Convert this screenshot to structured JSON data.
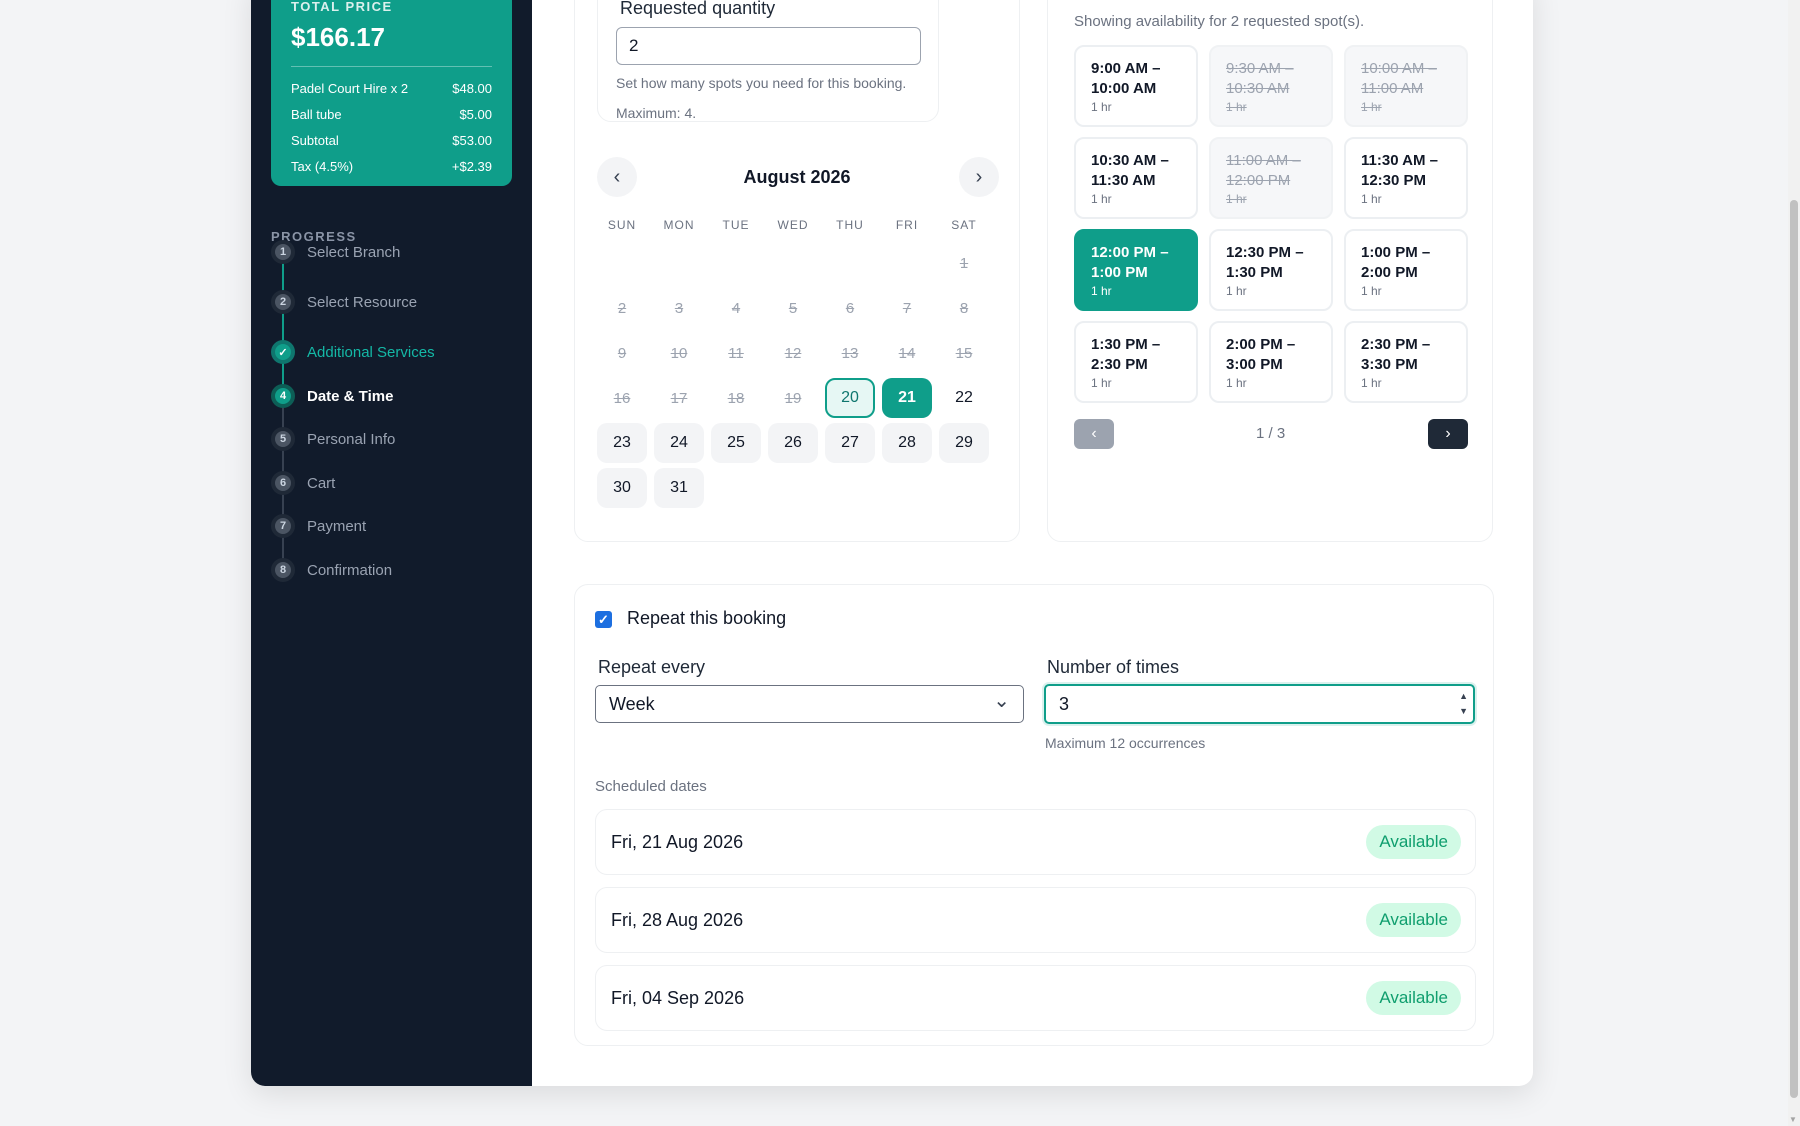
{
  "price": {
    "label": "TOTAL PRICE",
    "total": "$166.17",
    "rows": [
      {
        "name": "Padel Court Hire x 2",
        "amount": "$48.00"
      },
      {
        "name": "Ball tube",
        "amount": "$5.00"
      },
      {
        "name": "Subtotal",
        "amount": "$53.00"
      },
      {
        "name": "Tax (4.5%)",
        "amount": "+$2.39"
      }
    ]
  },
  "progress": {
    "title": "PROGRESS",
    "steps": [
      {
        "num": "1",
        "label": "Select Branch",
        "state": "pending"
      },
      {
        "num": "2",
        "label": "Select Resource",
        "state": "pending"
      },
      {
        "num": "✓",
        "label": "Additional Services",
        "state": "done"
      },
      {
        "num": "4",
        "label": "Date & Time",
        "state": "current"
      },
      {
        "num": "5",
        "label": "Personal Info",
        "state": "pending"
      },
      {
        "num": "6",
        "label": "Cart",
        "state": "pending"
      },
      {
        "num": "7",
        "label": "Payment",
        "state": "pending"
      },
      {
        "num": "8",
        "label": "Confirmation",
        "state": "pending"
      }
    ]
  },
  "quantity": {
    "label": "Requested quantity",
    "value": "2",
    "help": "Set how many spots you need for this booking.",
    "max": "Maximum: 4."
  },
  "calendar": {
    "month": "August 2026",
    "prev_icon": "‹",
    "next_icon": "›",
    "dow": [
      "SUN",
      "MON",
      "TUE",
      "WED",
      "THU",
      "FRI",
      "SAT"
    ],
    "weeks": [
      [
        null,
        null,
        null,
        null,
        null,
        null,
        {
          "d": "1",
          "s": "past"
        }
      ],
      [
        {
          "d": "2",
          "s": "past"
        },
        {
          "d": "3",
          "s": "past"
        },
        {
          "d": "4",
          "s": "past"
        },
        {
          "d": "5",
          "s": "past"
        },
        {
          "d": "6",
          "s": "past"
        },
        {
          "d": "7",
          "s": "past"
        },
        {
          "d": "8",
          "s": "past"
        }
      ],
      [
        {
          "d": "9",
          "s": "past"
        },
        {
          "d": "10",
          "s": "past"
        },
        {
          "d": "11",
          "s": "past"
        },
        {
          "d": "12",
          "s": "past"
        },
        {
          "d": "13",
          "s": "past"
        },
        {
          "d": "14",
          "s": "past"
        },
        {
          "d": "15",
          "s": "past"
        }
      ],
      [
        {
          "d": "16",
          "s": "past"
        },
        {
          "d": "17",
          "s": "past"
        },
        {
          "d": "18",
          "s": "past"
        },
        {
          "d": "19",
          "s": "past"
        },
        {
          "d": "20",
          "s": "today"
        },
        {
          "d": "21",
          "s": "selected"
        },
        {
          "d": "22",
          "s": "normal"
        }
      ],
      [
        {
          "d": "23",
          "s": "avail"
        },
        {
          "d": "24",
          "s": "avail"
        },
        {
          "d": "25",
          "s": "avail"
        },
        {
          "d": "26",
          "s": "avail"
        },
        {
          "d": "27",
          "s": "avail"
        },
        {
          "d": "28",
          "s": "avail"
        },
        {
          "d": "29",
          "s": "avail"
        }
      ],
      [
        {
          "d": "30",
          "s": "avail"
        },
        {
          "d": "31",
          "s": "avail"
        },
        null,
        null,
        null,
        null,
        null
      ]
    ]
  },
  "slots": {
    "info": "Showing availability for 2 requested spot(s).",
    "items": [
      {
        "time": "9:00 AM –\n10:00 AM",
        "dur": "1 hr",
        "state": "open"
      },
      {
        "time": "9:30 AM –\n10:30 AM",
        "dur": "1 hr",
        "state": "booked"
      },
      {
        "time": "10:00 AM –\n11:00 AM",
        "dur": "1 hr",
        "state": "booked"
      },
      {
        "time": "10:30 AM –\n11:30 AM",
        "dur": "1 hr",
        "state": "open"
      },
      {
        "time": "11:00 AM –\n12:00 PM",
        "dur": "1 hr",
        "state": "booked"
      },
      {
        "time": "11:30 AM –\n12:30 PM",
        "dur": "1 hr",
        "state": "open"
      },
      {
        "time": "12:00 PM –\n1:00 PM",
        "dur": "1 hr",
        "state": "selected"
      },
      {
        "time": "12:30 PM –\n1:30 PM",
        "dur": "1 hr",
        "state": "open"
      },
      {
        "time": "1:00 PM –\n2:00 PM",
        "dur": "1 hr",
        "state": "open"
      },
      {
        "time": "1:30 PM –\n2:30 PM",
        "dur": "1 hr",
        "state": "open"
      },
      {
        "time": "2:00 PM –\n3:00 PM",
        "dur": "1 hr",
        "state": "open"
      },
      {
        "time": "2:30 PM –\n3:30 PM",
        "dur": "1 hr",
        "state": "open"
      }
    ],
    "page": "1 / 3",
    "prev_icon": "‹",
    "next_icon": "›"
  },
  "repeat": {
    "checkbox_label": "Repeat this booking",
    "checked_icon": "✓",
    "every_label": "Repeat every",
    "every_value": "Week",
    "chevron_icon": "⌄",
    "times_label": "Number of times",
    "times_value": "3",
    "times_help": "Maximum 12 occurrences",
    "scheduled_title": "Scheduled dates",
    "dates": [
      {
        "date": "Fri, 21 Aug 2026",
        "status": "Available"
      },
      {
        "date": "Fri, 28 Aug 2026",
        "status": "Available"
      },
      {
        "date": "Fri, 04 Sep 2026",
        "status": "Available"
      }
    ]
  },
  "colors": {
    "accent": "#0f9e8a",
    "sidebar": "#111b2b",
    "badge_bg": "#d1fae5"
  }
}
